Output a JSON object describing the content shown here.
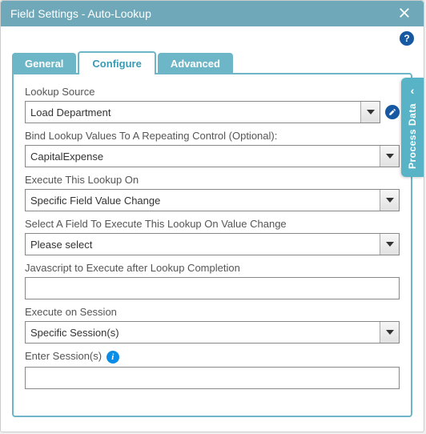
{
  "title": "Field Settings - Auto-Lookup",
  "tabs": {
    "general": "General",
    "configure": "Configure",
    "advanced": "Advanced"
  },
  "sideTab": "Process Data",
  "labels": {
    "lookupSource": "Lookup Source",
    "bindRepeating": "Bind Lookup Values To A Repeating Control (Optional):",
    "executeOn": "Execute This Lookup On",
    "selectField": "Select A Field To Execute This Lookup On Value Change",
    "jsAfter": "Javascript to Execute after Lookup Completion",
    "executeSession": "Execute on Session",
    "enterSessions": "Enter Session(s)"
  },
  "values": {
    "lookupSource": "Load Department",
    "bindRepeating": "CapitalExpense",
    "executeOn": "Specific Field Value Change",
    "selectField": "Please select",
    "jsAfter": "",
    "executeSession": "Specific Session(s)",
    "enterSessions": ""
  }
}
